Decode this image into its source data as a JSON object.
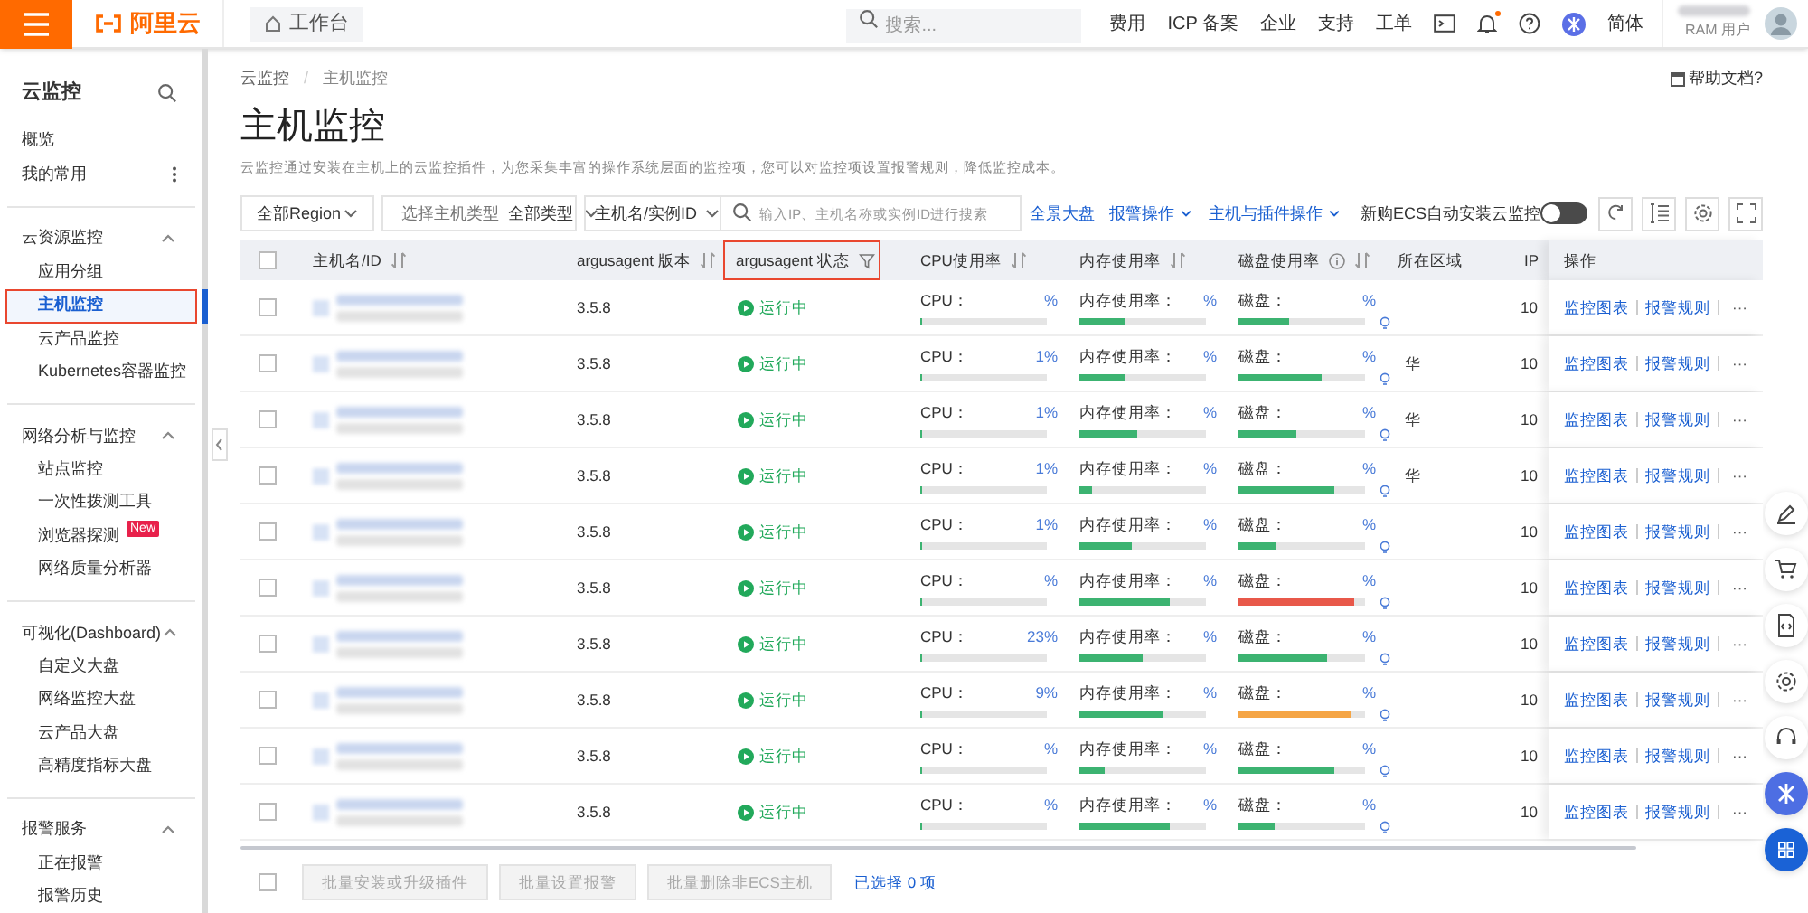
{
  "topbar": {
    "logo": "阿里云",
    "workbench_tab": "工作台",
    "search": {
      "placeholder": "搜索..."
    },
    "nav": [
      "费用",
      "ICP 备案",
      "企业",
      "支持",
      "工单"
    ],
    "notification_dot": true,
    "language": "简体",
    "user_role": "RAM 用户"
  },
  "sidebar": {
    "title": "云监控",
    "items": [
      {
        "label": "概览",
        "selected": false
      },
      {
        "label": "我的常用",
        "selected": false,
        "more": true
      }
    ],
    "groups": [
      {
        "label": "云资源监控",
        "expanded": true,
        "children": [
          {
            "label": "应用分组",
            "selected": false
          },
          {
            "label": "主机监控",
            "selected": true
          },
          {
            "label": "云产品监控",
            "selected": false
          },
          {
            "label": "Kubernetes容器监控",
            "selected": false
          }
        ]
      },
      {
        "label": "网络分析与监控",
        "expanded": true,
        "children": [
          {
            "label": "站点监控",
            "selected": false
          },
          {
            "label": "一次性拨测工具",
            "selected": false
          },
          {
            "label": "浏览器探测",
            "selected": false,
            "badge": "New"
          },
          {
            "label": "网络质量分析器",
            "selected": false
          }
        ]
      },
      {
        "label": "可视化(Dashboard)",
        "expanded": true,
        "children": [
          {
            "label": "自定义大盘",
            "selected": false
          },
          {
            "label": "网络监控大盘",
            "selected": false
          },
          {
            "label": "云产品大盘",
            "selected": false
          },
          {
            "label": "高精度指标大盘",
            "selected": false
          }
        ]
      },
      {
        "label": "报警服务",
        "expanded": true,
        "children": [
          {
            "label": "正在报警",
            "selected": false
          },
          {
            "label": "报警历史",
            "selected": false
          }
        ]
      }
    ]
  },
  "breadcrumb": [
    {
      "label": "云监控"
    },
    {
      "separator": "/",
      "label": "主机监控"
    }
  ],
  "help_link": "帮助文档?",
  "page_title": "主机监控",
  "description": "云监控通过安装在主机上的云监控插件，为您采集丰富的操作系统层面的监控项，您可以对监控项设置报警规则，降低监控成本。",
  "filters": {
    "region": "全部Region",
    "host_type_label": "选择主机类型",
    "host_type": "全部类型",
    "search_by": "主机名/实例ID",
    "search_placeholder": "输入IP、主机名称或实例ID进行搜索"
  },
  "actions": [
    {
      "label": "全景大盘",
      "dropdown": false
    },
    {
      "label": "报警操作",
      "dropdown": true
    },
    {
      "label": "主机与插件操作",
      "dropdown": true
    }
  ],
  "auto_install": {
    "label": "新购ECS自动安装云监控",
    "on": false
  },
  "table": {
    "header_checked": false,
    "columns": [
      {
        "label": "主机名/ID",
        "sortable": true
      },
      {
        "label": "argusagent 版本",
        "sortable": true
      },
      {
        "label": "argusagent 状态",
        "filter": true
      },
      {
        "label": "CPU使用率",
        "sortable": true
      },
      {
        "label": "内存使用率",
        "sortable": true
      },
      {
        "label": "磁盘使用率",
        "sortable": true,
        "info": true
      },
      {
        "label": "所在区域"
      },
      {
        "label": "IP"
      },
      {
        "label": "操作"
      }
    ],
    "rows": [
      {
        "checked": false,
        "version": "3.5.8",
        "status": "运行中",
        "cpu": {
          "label": "CPU：",
          "value": "%",
          "level": 0.02
        },
        "memory": {
          "label": "内存使用率：",
          "value": "%",
          "level": 0.35
        },
        "disk": {
          "label": "磁盘：",
          "value": "%",
          "level": 0.4,
          "color": "#3cb371"
        },
        "ip": "10",
        "chart_link": "监控图表",
        "alarm_link": "报警规则",
        "more": "···"
      },
      {
        "checked": false,
        "version": "3.5.8",
        "status": "运行中",
        "cpu": {
          "label": "CPU：",
          "prefix": "1",
          "value": "%",
          "level": 0.02
        },
        "memory": {
          "label": "内存使用率：",
          "value": "%",
          "level": 0.35
        },
        "disk": {
          "label": "磁盘：",
          "value": "%",
          "level": 0.65,
          "color": "#3cb371"
        },
        "region": "华",
        "ip": "10",
        "chart_link": "监控图表",
        "alarm_link": "报警规则",
        "more": "···"
      },
      {
        "checked": false,
        "version": "3.5.8",
        "status": "运行中",
        "cpu": {
          "label": "CPU：",
          "prefix": "1",
          "value": "%",
          "level": 0.02
        },
        "memory": {
          "label": "内存使用率：",
          "value": "%",
          "level": 0.45
        },
        "disk": {
          "label": "磁盘：",
          "value": "%",
          "level": 0.45,
          "color": "#3cb371"
        },
        "region": "华",
        "ip": "10",
        "chart_link": "监控图表",
        "alarm_link": "报警规则",
        "more": "···"
      },
      {
        "checked": false,
        "version": "3.5.8",
        "status": "运行中",
        "cpu": {
          "label": "CPU：",
          "prefix": "1",
          "value": "%",
          "level": 0.02
        },
        "memory": {
          "label": "内存使用率：",
          "value": "%",
          "level": 0.1
        },
        "disk": {
          "label": "磁盘：",
          "value": "%",
          "level": 0.75,
          "color": "#3cb371"
        },
        "region": "华",
        "ip": "10",
        "chart_link": "监控图表",
        "alarm_link": "报警规则",
        "more": "···"
      },
      {
        "checked": false,
        "version": "3.5.8",
        "status": "运行中",
        "cpu": {
          "label": "CPU：",
          "prefix": "1",
          "value": "%",
          "level": 0.02
        },
        "memory": {
          "label": "内存使用率：",
          "value": "%",
          "level": 0.42
        },
        "disk": {
          "label": "磁盘：",
          "value": "%",
          "level": 0.3,
          "color": "#3cb371"
        },
        "ip": "10",
        "chart_link": "监控图表",
        "alarm_link": "报警规则",
        "more": "···"
      },
      {
        "checked": false,
        "version": "3.5.8",
        "status": "运行中",
        "cpu": {
          "label": "CPU：",
          "value": "%",
          "level": 0.02
        },
        "memory": {
          "label": "内存使用率：",
          "value": "%",
          "level": 0.72
        },
        "disk": {
          "label": "磁盘：",
          "value": "%",
          "level": 0.92,
          "color": "#e8584a"
        },
        "ip": "10",
        "chart_link": "监控图表",
        "alarm_link": "报警规则",
        "more": "···"
      },
      {
        "checked": false,
        "version": "3.5.8",
        "status": "运行中",
        "cpu": {
          "label": "CPU：",
          "value": "23%",
          "level": 0.02
        },
        "memory": {
          "label": "内存使用率：",
          "value": "%",
          "level": 0.5
        },
        "disk": {
          "label": "磁盘：",
          "value": "%",
          "level": 0.7,
          "color": "#3cb371"
        },
        "ip": "10",
        "chart_link": "监控图表",
        "alarm_link": "报警规则",
        "more": "···"
      },
      {
        "checked": false,
        "version": "3.5.8",
        "status": "运行中",
        "cpu": {
          "label": "CPU：",
          "value": "9%",
          "level": 0.02
        },
        "memory": {
          "label": "内存使用率：",
          "value": "%",
          "level": 0.66
        },
        "disk": {
          "label": "磁盘：",
          "value": "%",
          "level": 0.88,
          "color": "#f5a545"
        },
        "ip": "10",
        "chart_link": "监控图表",
        "alarm_link": "报警规则",
        "more": "···"
      },
      {
        "checked": false,
        "version": "3.5.8",
        "status": "运行中",
        "cpu": {
          "label": "CPU：",
          "value": "%",
          "level": 0.02
        },
        "memory": {
          "label": "内存使用率：",
          "value": "%",
          "level": 0.2
        },
        "disk": {
          "label": "磁盘：",
          "value": "%",
          "level": 0.75,
          "color": "#3cb371"
        },
        "ip": "10",
        "chart_link": "监控图表",
        "alarm_link": "报警规则",
        "more": "···"
      },
      {
        "checked": false,
        "version": "3.5.8",
        "status": "运行中",
        "cpu": {
          "label": "CPU：",
          "value": "%",
          "level": 0.02
        },
        "memory": {
          "label": "内存使用率：",
          "value": "%",
          "level": 0.72
        },
        "disk": {
          "label": "磁盘：",
          "value": "%",
          "level": 0.28,
          "color": "#3cb371"
        },
        "ip": "10",
        "chart_link": "监控图表",
        "alarm_link": "报警规则",
        "more": "···"
      }
    ]
  },
  "batch": {
    "checked": false,
    "buttons": [
      "批量安装或升级插件",
      "批量设置报警",
      "批量删除非ECS主机"
    ],
    "selected_text": "已选择 0 项"
  }
}
